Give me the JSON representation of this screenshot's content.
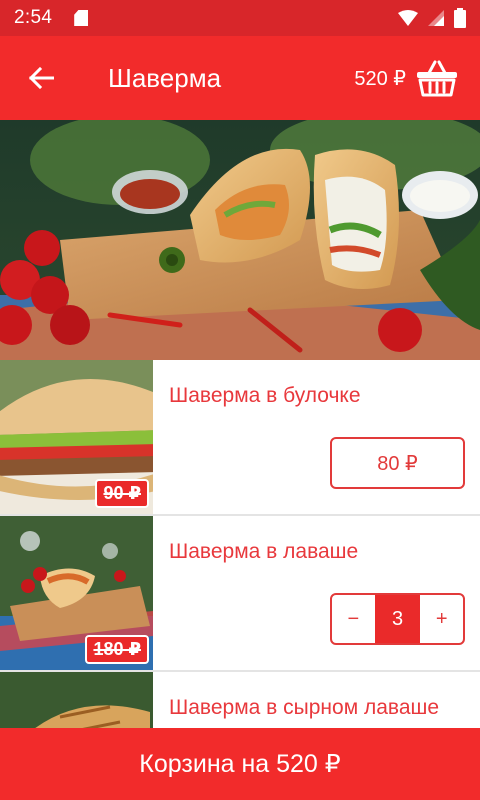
{
  "status_bar": {
    "time": "2:54"
  },
  "app_bar": {
    "title": "Шаверма",
    "cart_total": "520 ₽"
  },
  "items": [
    {
      "name": "Шаверма в булочке",
      "price": "80 ₽",
      "old_price": "90 ₽"
    },
    {
      "name": "Шаверма в лаваше",
      "quantity": "3",
      "minus": "−",
      "plus": "+",
      "old_price": "180 ₽"
    },
    {
      "name": "Шаверма в сырном лаваше"
    }
  ],
  "bottom_bar": {
    "label": "Корзина на 520 ₽"
  },
  "colors": {
    "primary": "#f22b2b",
    "status": "#d8262a",
    "accent_text": "#e8383c"
  }
}
